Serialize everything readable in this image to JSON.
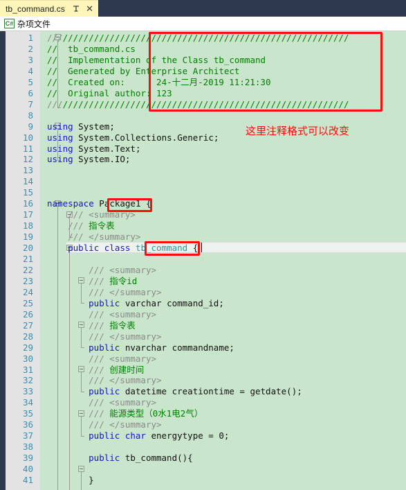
{
  "window": {
    "tab": {
      "title": "tb_command.cs",
      "pin_icon": "pin-icon",
      "close_icon": "close-icon",
      "close_glyph": "✕"
    },
    "breadcrumb": {
      "icon_label": "C#",
      "icon_name": "csharp-file-icon",
      "text": "杂项文件"
    }
  },
  "editor": {
    "language": "csharp",
    "current_line": 20,
    "first_line": 1,
    "last_line": 41,
    "colors": {
      "background": "#c9e5cb",
      "gutter": "#e3e3e3",
      "line_number": "#3f8ba8",
      "comment": "#008000",
      "doc_comment": "#8a8a8a",
      "keyword": "#1414cf",
      "type": "#1f9e9e",
      "plain_text": "#111111",
      "annotation": "#fb0d0d",
      "tab_background": "#fdf6b8",
      "titlebar": "#2d3a4d"
    },
    "lines": [
      {
        "n": 1,
        "text": "//////////////////////////////////////////////////////////"
      },
      {
        "n": 2,
        "text": "//  tb_command.cs"
      },
      {
        "n": 3,
        "text": "//  Implementation of the Class tb_command"
      },
      {
        "n": 4,
        "text": "//  Generated by Enterprise Architect"
      },
      {
        "n": 5,
        "text": "//  Created on:      24-十二月-2019 11:21:30"
      },
      {
        "n": 6,
        "text": "//  Original author: 123"
      },
      {
        "n": 7,
        "text": "//////////////////////////////////////////////////////////"
      },
      {
        "n": 8,
        "text": ""
      },
      {
        "n": 9,
        "text": "using System;"
      },
      {
        "n": 10,
        "text": "using System.Collections.Generic;"
      },
      {
        "n": 11,
        "text": "using System.Text;"
      },
      {
        "n": 12,
        "text": "using System.IO;"
      },
      {
        "n": 13,
        "text": ""
      },
      {
        "n": 14,
        "text": ""
      },
      {
        "n": 15,
        "text": ""
      },
      {
        "n": 16,
        "text": "namespace Package1 {"
      },
      {
        "n": 17,
        "text": "    /// <summary>"
      },
      {
        "n": 18,
        "text": "    /// 指令表"
      },
      {
        "n": 19,
        "text": "    /// </summary>"
      },
      {
        "n": 20,
        "text": "    public class tb_command {"
      },
      {
        "n": 21,
        "text": ""
      },
      {
        "n": 22,
        "text": "        /// <summary>"
      },
      {
        "n": 23,
        "text": "        /// 指令id"
      },
      {
        "n": 24,
        "text": "        /// </summary>"
      },
      {
        "n": 25,
        "text": "        public varchar command_id;"
      },
      {
        "n": 26,
        "text": "        /// <summary>"
      },
      {
        "n": 27,
        "text": "        /// 指令表"
      },
      {
        "n": 28,
        "text": "        /// </summary>"
      },
      {
        "n": 29,
        "text": "        public nvarchar commandname;"
      },
      {
        "n": 30,
        "text": "        /// <summary>"
      },
      {
        "n": 31,
        "text": "        /// 创建时间"
      },
      {
        "n": 32,
        "text": "        /// </summary>"
      },
      {
        "n": 33,
        "text": "        public datetime creationtime = getdate();"
      },
      {
        "n": 34,
        "text": "        /// <summary>"
      },
      {
        "n": 35,
        "text": "        /// 能源类型（0水1电2气）"
      },
      {
        "n": 36,
        "text": "        /// </summary>"
      },
      {
        "n": 37,
        "text": "        public char energytype = 0;"
      },
      {
        "n": 38,
        "text": ""
      },
      {
        "n": 39,
        "text": "        public tb_command(){"
      },
      {
        "n": 40,
        "text": ""
      },
      {
        "n": 41,
        "text": "        }"
      }
    ]
  },
  "annotations": {
    "header_box_label": "header-comment-highlight",
    "namespace_box_label": "namespace-name-highlight",
    "classname_box_label": "class-name-highlight",
    "note_text": "这里注释格式可以改变"
  }
}
